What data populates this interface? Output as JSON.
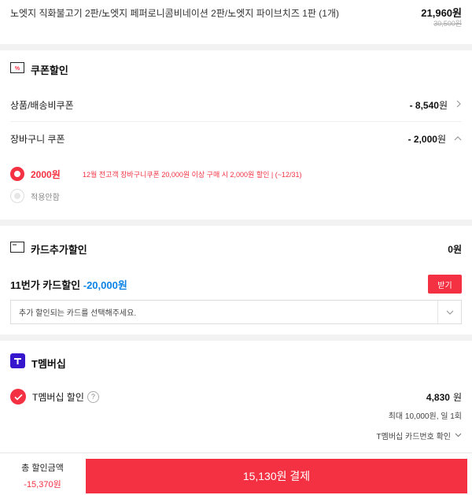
{
  "product": {
    "name": "노엣지 직화불고기 2판/노엣지 페퍼로니콤비네이션 2판/노엣지 파이브치즈 1판 (1개)",
    "price": "21,960원",
    "original_price": "30,500원"
  },
  "coupon": {
    "title": "쿠폰할인",
    "rows": [
      {
        "label": "상품/배송비쿠폰",
        "amount": "- 8,540",
        "unit": "원"
      },
      {
        "label": "장바구니 쿠폰",
        "amount": "- 2,000",
        "unit": "원"
      }
    ],
    "options": [
      {
        "amount": "2000원",
        "desc": "12월 전고객 장바구니쿠폰 20,000원 이상 구매 시 2,000원 할인 | (~12/31)",
        "selected": true
      },
      {
        "label": "적용안함",
        "selected": false
      }
    ]
  },
  "card": {
    "title": "카드추가할인",
    "amount": "0원",
    "promo_label": "11번가 카드할인",
    "promo_amount": "-20,000원",
    "receive_button": "받기",
    "select_placeholder": "추가 할인되는 카드를 선택해주세요."
  },
  "tmembership": {
    "title": "T멤버십",
    "discount_label": "T멤버십 할인",
    "help": "?",
    "amount": "4,830",
    "unit": "원",
    "limit": "최대 10,000원, 일 1회",
    "card_check": "T멤버십 카드번호 확인"
  },
  "footer": {
    "total_label": "총 할인금액",
    "total_value": "-15,370원",
    "pay_button": "15,130원 결제"
  },
  "colors": {
    "accent": "#f43142",
    "blue": "#0b83e6",
    "tmembership_purple": "#3617ce"
  }
}
